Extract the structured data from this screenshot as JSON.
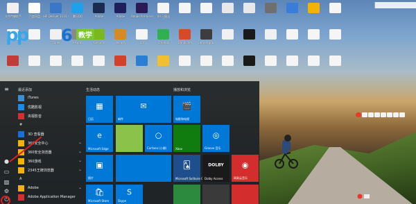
{
  "desktop": {
    "icons": [
      {
        "label": "文件传输助手",
        "color": "#f0f0f0"
      },
      {
        "label": "百度网盘",
        "color": "#ffffff"
      },
      {
        "label": "HP Deskjet 1110 series",
        "color": "#3a77c6"
      },
      {
        "label": "腾讯QQ",
        "color": "#20a0e8"
      },
      {
        "label": "Adobe",
        "color": "#1b2a50"
      },
      {
        "label": "Adobe",
        "color": "#1f1f5c"
      },
      {
        "label": "Adobe Premiere",
        "color": "#2a1a55"
      },
      {
        "label": "00 日报告",
        "color": "#f5f5f5"
      },
      {
        "label": "",
        "color": "#f5f5f5"
      },
      {
        "label": "",
        "color": "#f5f5f5"
      },
      {
        "label": "",
        "color": "#e8e8e8"
      },
      {
        "label": "",
        "color": "#e8e8e8"
      },
      {
        "label": "",
        "color": "#6f6f6f"
      },
      {
        "label": "",
        "color": "#3a7dd8"
      },
      {
        "label": "",
        "color": "#f2b400"
      },
      {
        "label": "",
        "color": "#f5f5f5"
      },
      {
        "label": "",
        "color": "#f5f5f5"
      },
      {
        "label": "",
        "color": "#f5f5f5"
      },
      {
        "label": "iTunes",
        "color": "#f0f0f0"
      },
      {
        "label": "X-Andro",
        "color": "#8a8a8a"
      },
      {
        "label": "GeForce",
        "color": "#7bb81f"
      },
      {
        "label": "Recarry",
        "color": "#d88a22"
      },
      {
        "label": "Cre",
        "color": "#f5f5f5"
      },
      {
        "label": "Creation",
        "color": "#30b050"
      },
      {
        "label": "Bandicam",
        "color": "#d64a2a"
      },
      {
        "label": "Bannergrap",
        "color": "#3d3d3d"
      },
      {
        "label": "",
        "color": "#f0f0f0"
      },
      {
        "label": "",
        "color": "#1a1a1a"
      },
      {
        "label": "",
        "color": "#f0f0f0"
      },
      {
        "label": "",
        "color": "#f5f5f5"
      },
      {
        "label": "",
        "color": "#f5f5f5"
      },
      {
        "label": "",
        "color": "#f5f5f5"
      },
      {
        "label": "",
        "color": "#c23a3a"
      },
      {
        "label": "",
        "color": "#f5f5f5"
      },
      {
        "label": "",
        "color": "#f5f5f5"
      },
      {
        "label": "",
        "color": "#f5f5f5"
      },
      {
        "label": "",
        "color": "#f5f5f5"
      },
      {
        "label": "",
        "color": "#d4412a"
      },
      {
        "label": "",
        "color": "#2a7fd4"
      },
      {
        "label": "",
        "color": "#f0c030"
      },
      {
        "label": "",
        "color": "#f5f5f5"
      },
      {
        "label": "",
        "color": "#f5f5f5"
      },
      {
        "label": "",
        "color": "#f5f5f5"
      },
      {
        "label": "",
        "color": "#1a1a1a"
      },
      {
        "label": "",
        "color": "#f5f5f5"
      },
      {
        "label": "",
        "color": "#f5f5f5"
      },
      {
        "label": "",
        "color": "#f5f5f5"
      },
      {
        "label": "",
        "color": "#f5f5f5"
      }
    ],
    "watermark": {
      "pinyin": "pp",
      "number": "6",
      "tag": "教学"
    }
  },
  "start_menu": {
    "rail_icons": [
      "hamburger-icon",
      "user-icon",
      "document-icon",
      "pictures-icon",
      "settings-icon",
      "power-icon"
    ],
    "recent_header": "最近添加",
    "apps": [
      {
        "label": "iTunes",
        "color": "#3a8fd6",
        "chevron": false
      },
      {
        "label": "优酷影视",
        "color": "#1a8ce6",
        "chevron": false
      },
      {
        "label": "央视影音",
        "color": "#d32f2f",
        "chevron": false
      },
      {
        "label": "#",
        "color": "",
        "chevron": false,
        "header": true
      },
      {
        "label": "3D 查看器",
        "color": "#1a6fd6",
        "chevron": false
      },
      {
        "label": "360安全中心",
        "color": "#f2b400",
        "chevron": true
      },
      {
        "label": "360安全浏览器",
        "color": "#f2b400",
        "chevron": true
      },
      {
        "label": "360游戏",
        "color": "#f2b400",
        "chevron": true
      },
      {
        "label": "2345王牌浏览器",
        "color": "#f2b400",
        "chevron": true
      },
      {
        "label": "A",
        "color": "",
        "chevron": false,
        "header": true
      },
      {
        "label": "Adobe",
        "color": "#f2b400",
        "chevron": true
      },
      {
        "label": "Adobe Application Manager",
        "color": "#d32f2f",
        "chevron": false
      }
    ],
    "group1_header": "生活动态",
    "group2_header": "播放和浏览",
    "tiles": [
      {
        "label": "日历",
        "glyph": "▦",
        "color": "#0078d7"
      },
      {
        "label": "邮件",
        "glyph": "✉",
        "color": "#0078d7"
      },
      {
        "label": "Microsoft Edge",
        "glyph": "e",
        "color": "#0078d7"
      },
      {
        "label": "",
        "glyph": "",
        "color": "#8bc34a"
      },
      {
        "label": "Cortana (小娜)",
        "glyph": "○",
        "color": "#0078d7"
      },
      {
        "label": "照片",
        "glyph": "▣",
        "color": "#0078d7"
      },
      {
        "label": "",
        "glyph": "",
        "color": "#0078d7"
      },
      {
        "label": "Microsoft Store",
        "glyph": "🛍",
        "color": "#0078d7"
      },
      {
        "label": "Skype",
        "glyph": "S",
        "color": "#0078d7"
      },
      {
        "label": "电影和电视",
        "glyph": "🎬",
        "color": "#0078d7"
      },
      {
        "label": "Xbox",
        "glyph": "",
        "color": "#107c10"
      },
      {
        "label": "Groove 音乐",
        "glyph": "◎",
        "color": "#0078d7"
      },
      {
        "label": "Microsoft Solitaire Collection",
        "glyph": "🂡",
        "color": "#1e4e8c"
      },
      {
        "label": "Dolby Access",
        "glyph": "DOLBY",
        "color": "#1a1a1a"
      },
      {
        "label": "网易云音乐",
        "glyph": "◉",
        "color": "#d42d2d"
      },
      {
        "label": "",
        "glyph": "",
        "color": "#2b8a3e"
      },
      {
        "label": "",
        "glyph": "",
        "color": "#3a3a3a"
      },
      {
        "label": "",
        "glyph": "",
        "color": "#d42d2d"
      }
    ]
  }
}
